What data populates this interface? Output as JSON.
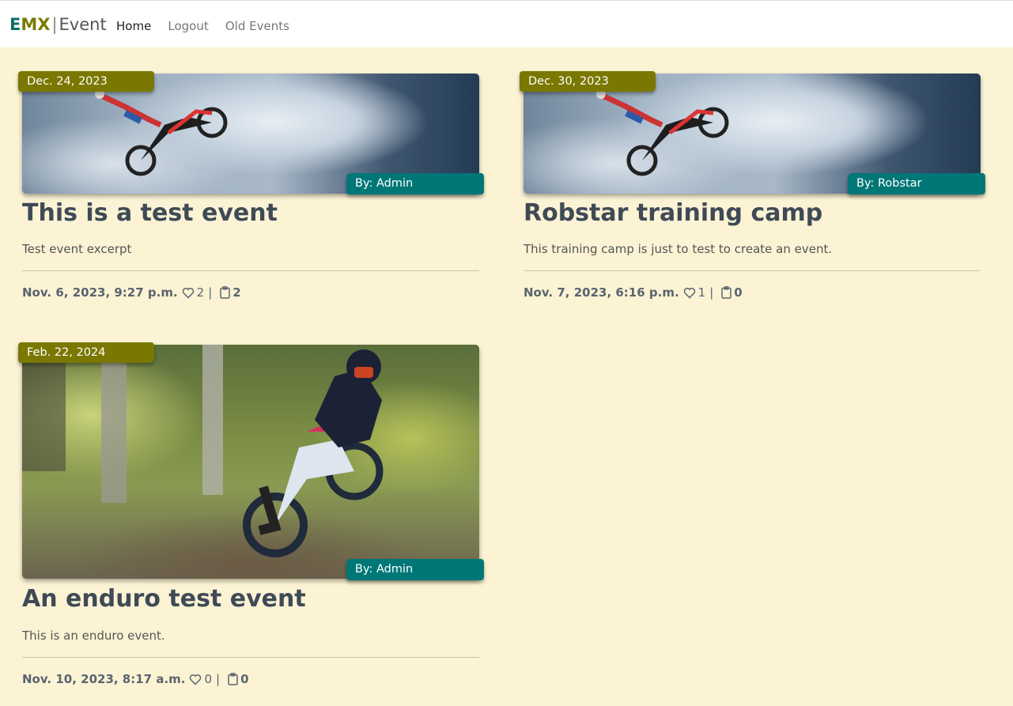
{
  "navbar": {
    "brand": {
      "e": "E",
      "mx": "MX",
      "sep": "|",
      "event": "Event"
    },
    "links": [
      {
        "label": "Home",
        "active": true
      },
      {
        "label": "Logout",
        "active": false
      },
      {
        "label": "Old Events",
        "active": false
      }
    ]
  },
  "events": [
    {
      "date": "Dec. 24, 2023",
      "author": "By: Admin",
      "title": "This is a test event",
      "excerpt": "Test event excerpt",
      "created": "Nov. 6, 2023, 9:27 p.m.",
      "likes": "2",
      "comments": "2",
      "image": "freestyle-motocross-sky"
    },
    {
      "date": "Dec. 30, 2023",
      "author": "By: Robstar",
      "title": "Robstar training camp",
      "excerpt": "This training camp is just to test to create an event.",
      "created": "Nov. 7, 2023, 6:16 p.m.",
      "likes": "1",
      "comments": "0",
      "image": "freestyle-motocross-sky"
    },
    {
      "date": "Feb. 22, 2024",
      "author": "By: Admin",
      "title": "An enduro test event",
      "excerpt": "This is an enduro event.",
      "created": "Nov. 10, 2023, 8:17 a.m.",
      "likes": "0",
      "comments": "0",
      "image": "enduro-rider-forest"
    }
  ],
  "meta": {
    "pipe": "|"
  },
  "icons": {
    "like": "heart-icon",
    "comment": "clipboard-icon"
  },
  "colors": {
    "background": "#fbf3d4",
    "date_badge": "#7a7800",
    "author_badge": "#007777",
    "brand_e": "#0f6b68",
    "brand_mx": "#7a7a00"
  }
}
